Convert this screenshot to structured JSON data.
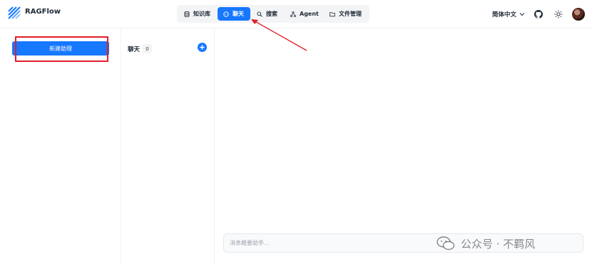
{
  "app": {
    "brand": "RAGFlow"
  },
  "nav": {
    "items": [
      {
        "label": "知识库",
        "icon": "database-icon"
      },
      {
        "label": "聊天",
        "icon": "chat-icon",
        "active": true
      },
      {
        "label": "搜索",
        "icon": "search-icon"
      },
      {
        "label": "Agent",
        "icon": "agent-icon"
      },
      {
        "label": "文件管理",
        "icon": "folder-icon"
      }
    ]
  },
  "header": {
    "language": "简体中文"
  },
  "sidebar": {
    "new_assistant_label": "新建助理"
  },
  "chat_list": {
    "title": "聊天",
    "count": "0"
  },
  "message": {
    "placeholder": "消息概要助手..."
  },
  "watermark": {
    "text": "公众号 · 不羁风"
  },
  "colors": {
    "accent": "#1677ff",
    "annotation": "#e11d2b"
  }
}
